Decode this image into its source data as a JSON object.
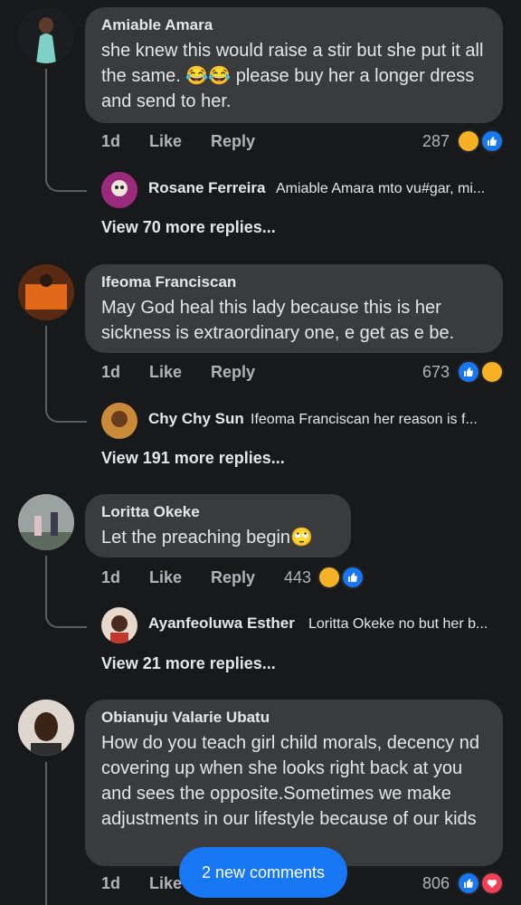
{
  "comments": [
    {
      "author": "Amiable Amara",
      "text": "she knew this would raise a stir but she put it all the same. 😂😂 please buy her a longer dress and send to her.",
      "time": "1d",
      "like": "Like",
      "reply": "Reply",
      "reaction_count": "287",
      "reactions": [
        "haha-icon",
        "like-icon"
      ],
      "preview": {
        "name": "Rosane Ferreira",
        "text": "Amiable Amara mto vu#gar, mi..."
      },
      "more_replies": "View 70 more replies..."
    },
    {
      "author": "Ifeoma Franciscan",
      "text": "May God heal this lady because this is her sickness is extraordinary one, e get as e be.",
      "time": "1d",
      "like": "Like",
      "reply": "Reply",
      "reaction_count": "673",
      "reactions": [
        "like-icon",
        "haha-icon"
      ],
      "preview": {
        "name": "Chy Chy Sun",
        "text": "Ifeoma Franciscan  her reason is f..."
      },
      "more_replies": "View 191 more replies..."
    },
    {
      "author": "Loritta Okeke",
      "text": "Let the preaching begin🙄",
      "time": "1d",
      "like": "Like",
      "reply": "Reply",
      "reaction_count": "443",
      "reactions": [
        "haha-icon",
        "like-icon"
      ],
      "preview": {
        "name": "Ayanfeoluwa Esther",
        "text": "Loritta Okeke no but her b..."
      },
      "more_replies": "View 21 more replies..."
    },
    {
      "author": "Obianuju Valarie Ubatu",
      "text": "How do you teach girl child morals, decency nd covering up when she looks right back at you and sees the opposite.Sometimes we make adjustments in our lifestyle because of our kids",
      "time": "1d",
      "like": "Like",
      "reaction_count": "806",
      "reactions": [
        "like-icon",
        "love-icon"
      ]
    }
  ],
  "new_comments_pill": "2 new comments",
  "colors": {
    "background": "#18191a",
    "bubble": "#3a3b3c",
    "accent": "#1877f2"
  }
}
